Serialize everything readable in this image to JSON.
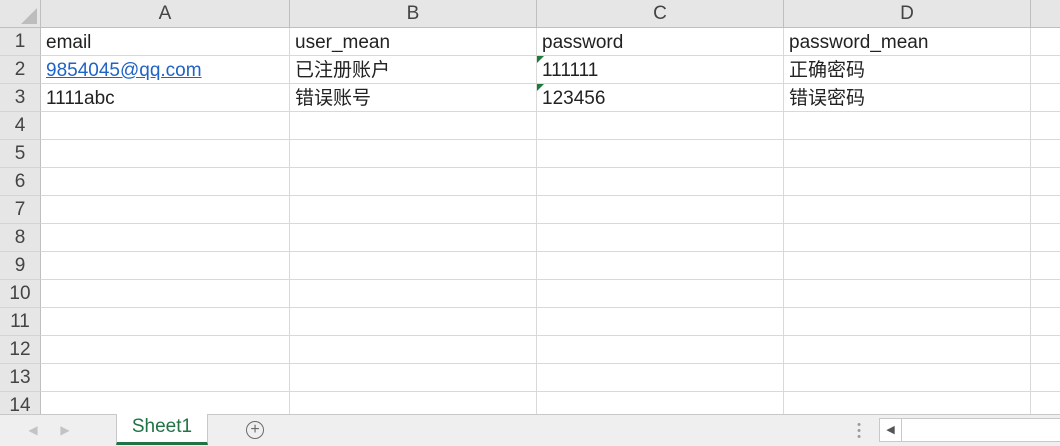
{
  "columns": [
    "A",
    "B",
    "C",
    "D"
  ],
  "rows": [
    "1",
    "2",
    "3",
    "4",
    "5",
    "6",
    "7",
    "8",
    "9",
    "10",
    "11",
    "12",
    "13",
    "14"
  ],
  "cells": {
    "r1": [
      "email",
      "user_mean",
      "password",
      "password_mean"
    ],
    "r2": [
      "9854045@qq.com",
      "已注册账户",
      "111111",
      "正确密码"
    ],
    "r3": [
      "1111abc",
      "错误账号",
      "123456",
      "错误密码"
    ]
  },
  "sheet_tabs": [
    "Sheet1"
  ],
  "icons": {
    "prev_sheet": "chevron-left-icon",
    "next_sheet": "chevron-right-icon",
    "add_sheet": "plus-circle-icon",
    "scroll_left": "scroll-left-arrow-icon",
    "split_handle": "vertical-dots-icon"
  },
  "colors": {
    "accent": "#217346",
    "hyperlink": "#1f63c6",
    "header_bg": "#e6e6e6",
    "gridline": "#d9d9d9",
    "error_flag": "#1f7a3a"
  }
}
